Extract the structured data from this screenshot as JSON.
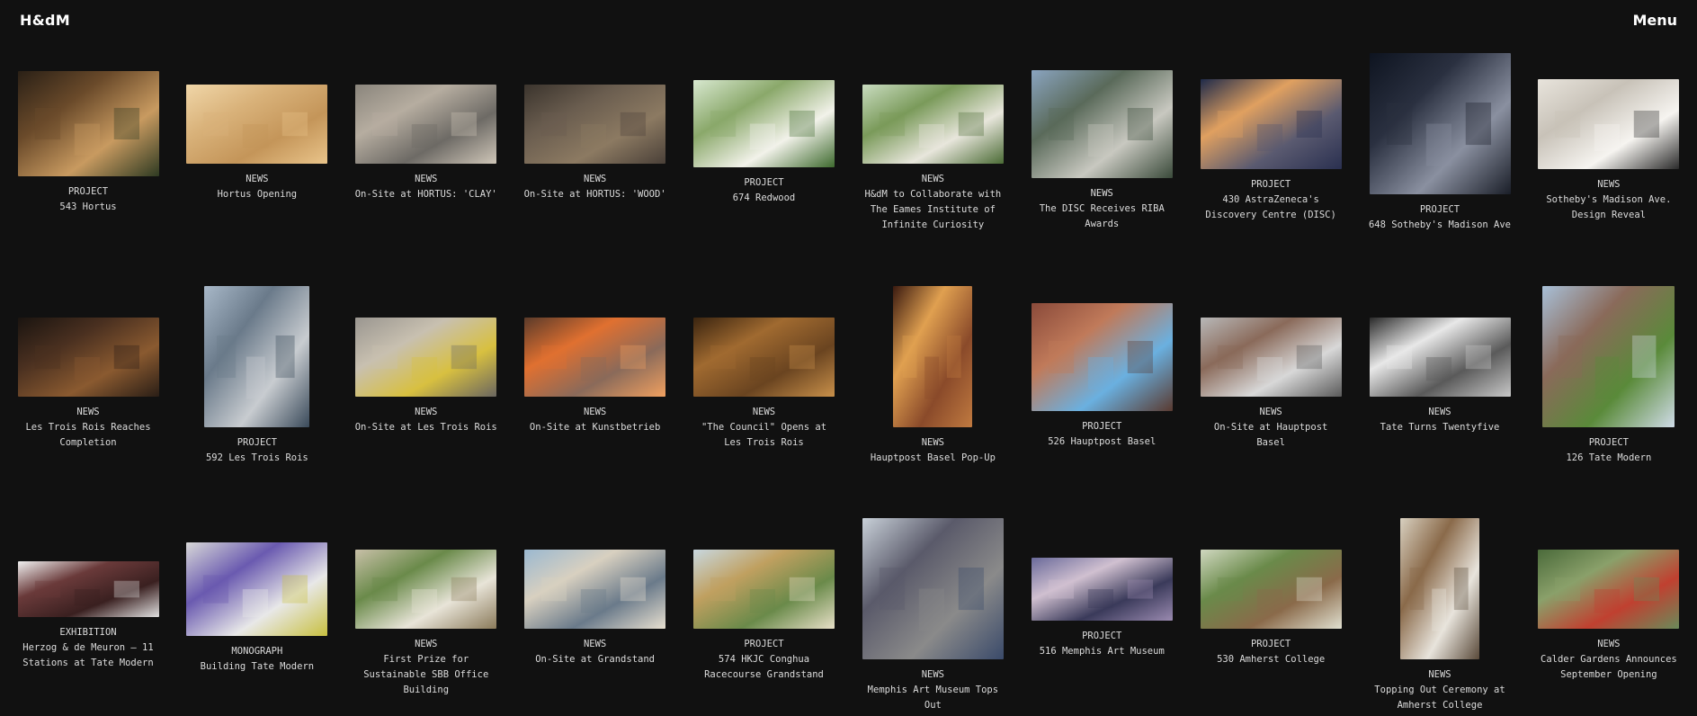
{
  "header": {
    "logo": "H&dM",
    "menu_label": "Menu"
  },
  "rows": [
    {
      "items": [
        {
          "type": "PROJECT",
          "title": "543 Hortus",
          "w": 157,
          "h": 117,
          "colors": [
            "#2a2016",
            "#6a4a2a",
            "#c89a60",
            "#2e3a22"
          ]
        },
        {
          "type": "NEWS",
          "title": "Hortus Opening",
          "w": 157,
          "h": 88,
          "colors": [
            "#f0d6a8",
            "#d9b27a",
            "#c49559",
            "#e9c48a"
          ]
        },
        {
          "type": "NEWS",
          "title": "On-Site at HORTUS: 'CLAY'",
          "w": 157,
          "h": 88,
          "colors": [
            "#8a857c",
            "#b6ada0",
            "#6d6a65",
            "#cfc6b8"
          ]
        },
        {
          "type": "NEWS",
          "title": "On-Site at HORTUS: 'WOOD'",
          "w": 157,
          "h": 88,
          "colors": [
            "#3b342d",
            "#6a5d4f",
            "#8c7a62",
            "#4a4038"
          ]
        },
        {
          "type": "PROJECT",
          "title": "674 Redwood",
          "w": 157,
          "h": 97,
          "colors": [
            "#d8e8d0",
            "#8aa86a",
            "#f2f2ea",
            "#3e6a2e"
          ]
        },
        {
          "type": "NEWS",
          "title": "H&dM to Collaborate with The Eames Institute of Infinite Curiosity",
          "w": 157,
          "h": 88,
          "colors": [
            "#c9dcc0",
            "#7a9a5a",
            "#e8e6dc",
            "#4b6b35"
          ]
        },
        {
          "type": "NEWS",
          "title": "The DISC Receives RIBA Awards",
          "w": 157,
          "h": 120,
          "colors": [
            "#8aa4c0",
            "#5a6a5a",
            "#c8c8c0",
            "#3a4a3a"
          ]
        },
        {
          "type": "PROJECT",
          "title": "430 AstraZeneca's Discovery Centre (DISC)",
          "w": 157,
          "h": 100,
          "colors": [
            "#1e2a4a",
            "#e0a060",
            "#5a5a70",
            "#2a3050"
          ]
        },
        {
          "type": "PROJECT",
          "title": "648 Sotheby's Madison Ave",
          "w": 157,
          "h": 157,
          "colors": [
            "#0e1420",
            "#2a3040",
            "#8a90a0",
            "#1a1e28"
          ]
        },
        {
          "type": "NEWS",
          "title": "Sotheby's Madison Ave. Design Reveal",
          "w": 157,
          "h": 100,
          "colors": [
            "#e8e4dc",
            "#c8c2b8",
            "#f6f4f0",
            "#2a2a2a"
          ]
        }
      ]
    },
    {
      "items": [
        {
          "type": "NEWS",
          "title": "Les Trois Rois Reaches Completion",
          "w": 157,
          "h": 88,
          "colors": [
            "#1a1410",
            "#4a3020",
            "#8a5a30",
            "#2a1e16"
          ]
        },
        {
          "type": "PROJECT",
          "title": "592 Les Trois Rois",
          "w": 117,
          "h": 157,
          "colors": [
            "#a8b8c8",
            "#6a7a8a",
            "#c8ccd0",
            "#3a4a5a"
          ]
        },
        {
          "type": "NEWS",
          "title": "On-Site at Les Trois Rois",
          "w": 157,
          "h": 88,
          "colors": [
            "#9a9690",
            "#c8c0b0",
            "#d8c040",
            "#6a6660"
          ]
        },
        {
          "type": "NEWS",
          "title": "On-Site at Kunstbetrieb",
          "w": 157,
          "h": 88,
          "colors": [
            "#5a3a2a",
            "#e07030",
            "#8a6a5a",
            "#f0a060"
          ]
        },
        {
          "type": "NEWS",
          "title": "\"The Council\" Opens at Les Trois Rois",
          "w": 157,
          "h": 88,
          "colors": [
            "#3a2410",
            "#a06a30",
            "#6a4420",
            "#c8904a"
          ]
        },
        {
          "type": "NEWS",
          "title": "Hauptpost Basel Pop-Up",
          "w": 88,
          "h": 157,
          "colors": [
            "#3a1a10",
            "#e0a050",
            "#8a4a2a",
            "#c07a40"
          ]
        },
        {
          "type": "PROJECT",
          "title": "526 Hauptpost Basel",
          "w": 157,
          "h": 120,
          "colors": [
            "#8a4a3a",
            "#c07a5a",
            "#6ab0e0",
            "#5a3a30"
          ]
        },
        {
          "type": "NEWS",
          "title": "On-Site at Hauptpost Basel",
          "w": 157,
          "h": 88,
          "colors": [
            "#b8b8b8",
            "#8a6a5a",
            "#d8d8d8",
            "#5a5a5a"
          ]
        },
        {
          "type": "NEWS",
          "title": "Tate Turns Twentyfive",
          "w": 157,
          "h": 88,
          "colors": [
            "#2a2a2a",
            "#e8e8e8",
            "#5a5a5a",
            "#c8c8c8"
          ]
        },
        {
          "type": "PROJECT",
          "title": "126 Tate Modern",
          "w": 147,
          "h": 157,
          "colors": [
            "#a8c0d8",
            "#8a6a5a",
            "#5a8a3a",
            "#d0dce8"
          ]
        }
      ]
    },
    {
      "items": [
        {
          "type": "EXHIBITION",
          "title": "Herzog & de Meuron – 11 Stations at Tate Modern",
          "w": 157,
          "h": 62,
          "colors": [
            "#f0f0f0",
            "#6a3a3a",
            "#3a2020",
            "#e0e0e0"
          ]
        },
        {
          "type": "MONOGRAPH",
          "title": "Building Tate Modern",
          "w": 157,
          "h": 104,
          "colors": [
            "#d8d8d8",
            "#6a5ab0",
            "#e8e8e8",
            "#c8c040"
          ]
        },
        {
          "type": "NEWS",
          "title": "First Prize for Sustainable SBB Office Building",
          "w": 157,
          "h": 88,
          "colors": [
            "#c8c0a8",
            "#6a8a4a",
            "#e8e4d8",
            "#8a7a5a"
          ]
        },
        {
          "type": "NEWS",
          "title": "On-Site at Grandstand",
          "w": 157,
          "h": 88,
          "colors": [
            "#9ab8d0",
            "#d8d0c0",
            "#6a7a8a",
            "#e8e0d0"
          ]
        },
        {
          "type": "PROJECT",
          "title": "574 HKJC Conghua Racecourse Grandstand",
          "w": 157,
          "h": 88,
          "colors": [
            "#c8d8e0",
            "#c0a060",
            "#6a8a4a",
            "#e8e0c8"
          ]
        },
        {
          "type": "NEWS",
          "title": "Memphis Art Museum Tops Out",
          "w": 157,
          "h": 157,
          "colors": [
            "#c8d0d8",
            "#5a5a6a",
            "#8a8a8a",
            "#3a4a6a"
          ]
        },
        {
          "type": "PROJECT",
          "title": "516 Memphis Art Museum",
          "w": 157,
          "h": 70,
          "colors": [
            "#6a6a9a",
            "#d0c0d0",
            "#3a3a5a",
            "#9a8ab0"
          ]
        },
        {
          "type": "PROJECT",
          "title": "530 Amherst College",
          "w": 157,
          "h": 88,
          "colors": [
            "#d0d8c0",
            "#6a8a4a",
            "#8a6a4a",
            "#e0e0d0"
          ]
        },
        {
          "type": "NEWS",
          "title": "Topping Out Ceremony at Amherst College",
          "w": 88,
          "h": 157,
          "colors": [
            "#d8d0c0",
            "#8a6a4a",
            "#e8e4dc",
            "#5a4a3a"
          ]
        },
        {
          "type": "NEWS",
          "title": "Calder Gardens Announces September Opening",
          "w": 157,
          "h": 88,
          "colors": [
            "#4a6a3a",
            "#8aa06a",
            "#c04030",
            "#6a8a5a"
          ]
        }
      ]
    }
  ]
}
